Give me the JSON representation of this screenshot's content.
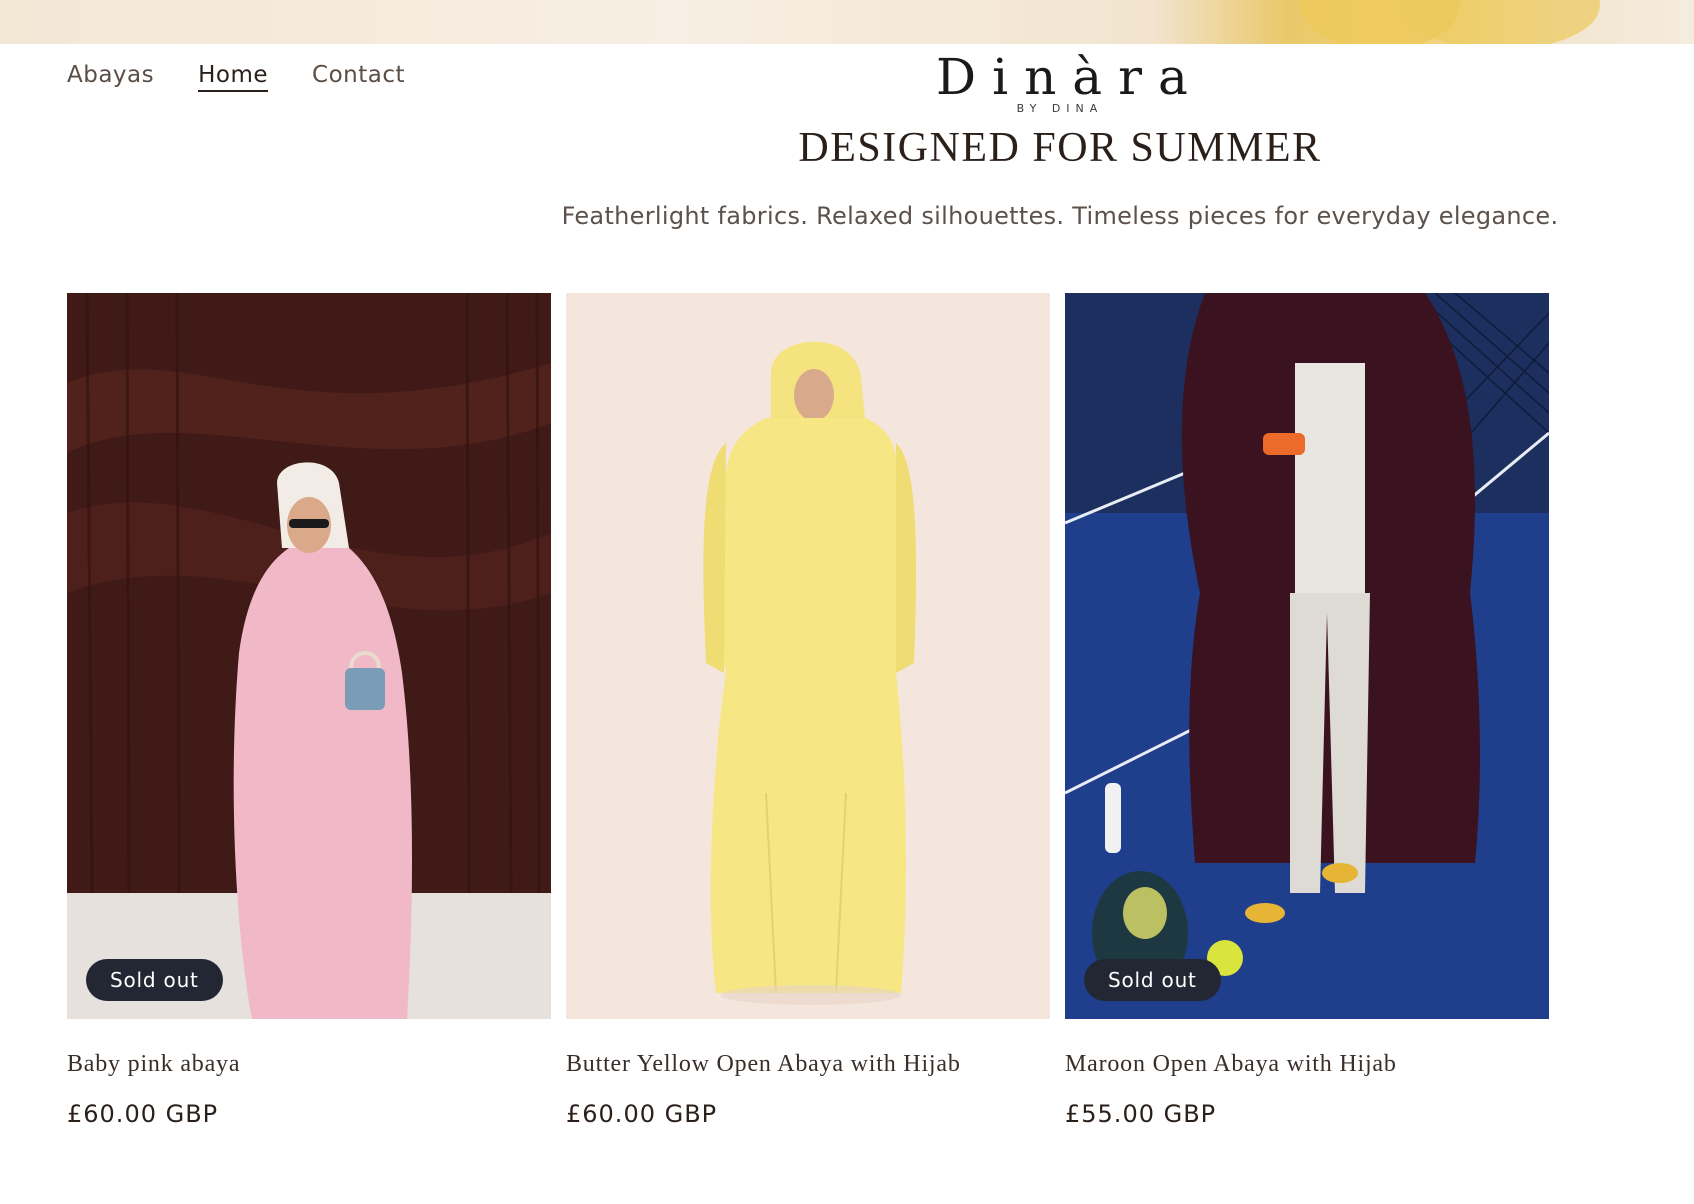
{
  "nav": {
    "items": [
      {
        "label": "Abayas",
        "active": false
      },
      {
        "label": "Home",
        "active": true
      },
      {
        "label": "Contact",
        "active": false
      }
    ]
  },
  "logo": {
    "main": "Dinàra",
    "sub": "BY DINA"
  },
  "hero": {
    "title": "DESIGNED FOR SUMMER",
    "subtitle": "Featherlight fabrics. Relaxed silhouettes. Timeless pieces for everyday elegance."
  },
  "products": [
    {
      "title": "Baby pink abaya",
      "price": "£60.00 GBP",
      "badge": "Sold out",
      "image": "pink-abaya-photo"
    },
    {
      "title": "Butter Yellow Open Abaya with Hijab",
      "price": "£60.00 GBP",
      "badge": "",
      "image": "yellow-abaya-photo"
    },
    {
      "title": "Maroon Open Abaya with Hijab",
      "price": "£55.00 GBP",
      "badge": "Sold out",
      "image": "maroon-abaya-photo"
    }
  ],
  "colors": {
    "badge_bg": "#232733",
    "text": "#2b1f1a",
    "accent_yellow": "#edc95c"
  }
}
